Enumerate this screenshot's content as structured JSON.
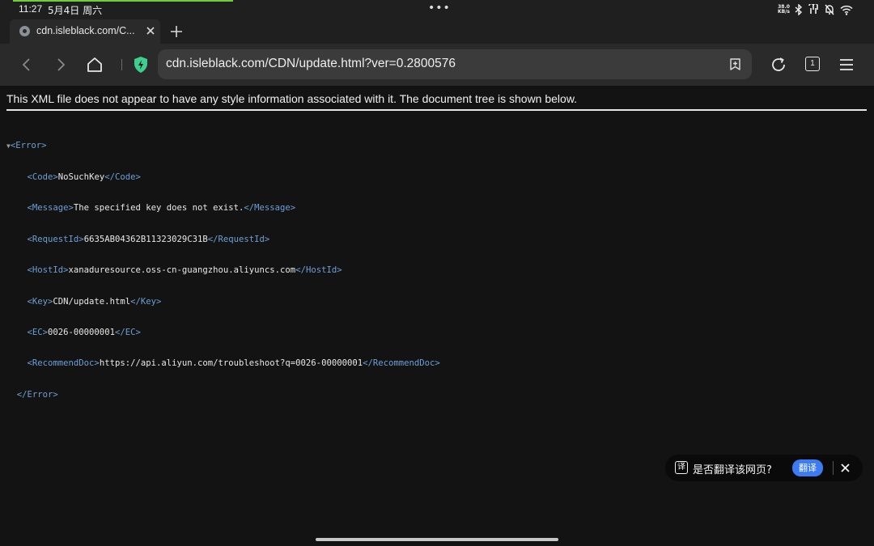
{
  "status_bar": {
    "time": "11:27",
    "date": "5月4日 周六",
    "dots": "•••",
    "net_speed_value": "38.0",
    "net_speed_unit": "KB/s",
    "icons": [
      "bluetooth-icon",
      "earbuds-icon",
      "mute-icon",
      "wifi-icon"
    ],
    "progress_color": "#6fce3c"
  },
  "tabs": [
    {
      "title": "cdn.isleblack.com/C...",
      "favicon": "globe-icon"
    }
  ],
  "toolbar": {
    "url": "cdn.isleblack.com/CDN/update.html?ver=0.2800576",
    "tab_count": "1",
    "shield_color": "#3ecf8e"
  },
  "page": {
    "info": "This XML file does not appear to have any style information associated with it. The document tree is shown below.",
    "xml": {
      "root_open": "<Error>",
      "root_close": "</Error>",
      "toggle": "▼",
      "nodes": [
        {
          "open": "<Code>",
          "text": "NoSuchKey",
          "close": "</Code>"
        },
        {
          "open": "<Message>",
          "text": "The specified key does not exist.",
          "close": "</Message>"
        },
        {
          "open": "<RequestId>",
          "text": "6635AB04362B11323029C31B",
          "close": "</RequestId>"
        },
        {
          "open": "<HostId>",
          "text": "xanaduresource.oss-cn-guangzhou.aliyuncs.com",
          "close": "</HostId>"
        },
        {
          "open": "<Key>",
          "text": "CDN/update.html",
          "close": "</Key>"
        },
        {
          "open": "<EC>",
          "text": "0026-00000001",
          "close": "</EC>"
        },
        {
          "open": "<RecommendDoc>",
          "text": "https://api.aliyun.com/troubleshoot?q=0026-00000001",
          "close": "</RecommendDoc>"
        }
      ]
    },
    "tag_color": "#6d9fd6"
  },
  "translate": {
    "icon_text": "译",
    "question": "是否翻译该网页?",
    "button_label": "翻译",
    "button_color": "#3d7bf2"
  }
}
